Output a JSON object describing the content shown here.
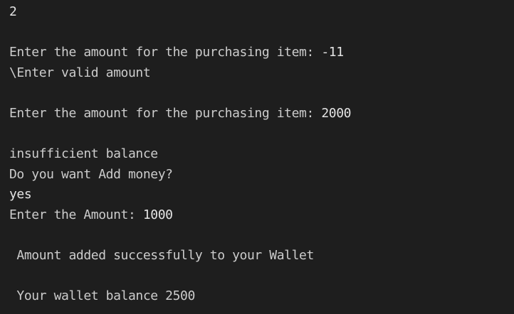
{
  "terminal": {
    "lines": [
      {
        "prompt": "",
        "input": "2"
      },
      {
        "prompt": "",
        "input": ""
      },
      {
        "prompt": "Enter the amount for the purchasing item: ",
        "input": "-11"
      },
      {
        "prompt": "\\Enter valid amount",
        "input": ""
      },
      {
        "prompt": "",
        "input": ""
      },
      {
        "prompt": "Enter the amount for the purchasing item: ",
        "input": "2000"
      },
      {
        "prompt": "",
        "input": ""
      },
      {
        "prompt": "insufficient balance",
        "input": ""
      },
      {
        "prompt": "Do you want Add money?",
        "input": ""
      },
      {
        "prompt": "",
        "input": "yes"
      },
      {
        "prompt": "Enter the Amount: ",
        "input": "1000"
      },
      {
        "prompt": "",
        "input": ""
      },
      {
        "prompt": " Amount added successfully to your Wallet",
        "input": ""
      },
      {
        "prompt": "",
        "input": ""
      },
      {
        "prompt": " Your wallet balance 2500",
        "input": ""
      }
    ]
  }
}
